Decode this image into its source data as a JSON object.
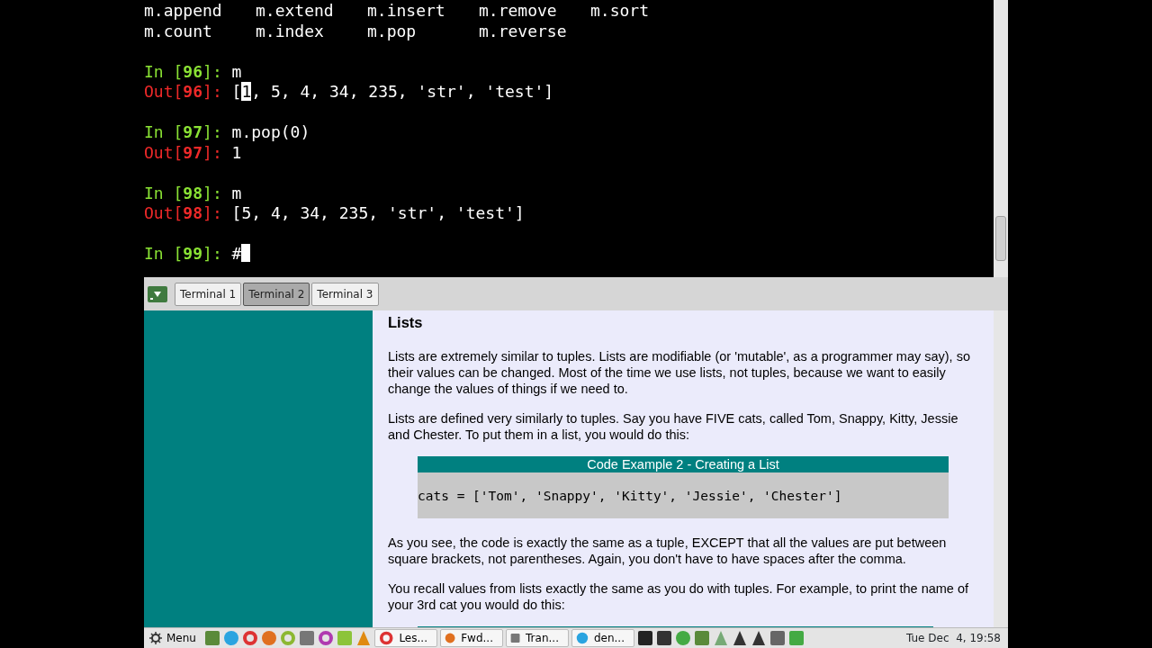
{
  "terminal": {
    "completions": [
      [
        "m.append",
        "m.extend",
        "m.insert",
        "m.remove",
        "m.sort"
      ],
      [
        "m.count",
        "m.index",
        "m.pop",
        "m.reverse"
      ]
    ],
    "entries": [
      {
        "kind": "blank"
      },
      {
        "kind": "in",
        "prompt": "In [**96**]:",
        "text": "m"
      },
      {
        "kind": "out",
        "prompt": "Out[**96**]:",
        "text": "[",
        "cursor_char": "1",
        "text_after": ", 5, 4, 34, 235, 'str', 'test']"
      },
      {
        "kind": "blank"
      },
      {
        "kind": "in",
        "prompt": "In [**97**]:",
        "text": "m.pop(0)"
      },
      {
        "kind": "out",
        "prompt": "Out[**97**]:",
        "text": "1"
      },
      {
        "kind": "blank"
      },
      {
        "kind": "in",
        "prompt": "In [**98**]:",
        "text": "m"
      },
      {
        "kind": "out",
        "prompt": "Out[**98**]:",
        "text": "[5, 4, 34, 235, 'str', 'test']"
      },
      {
        "kind": "blank"
      },
      {
        "kind": "in",
        "prompt": "In [**99**]:",
        "text": "#",
        "cursor": true
      }
    ]
  },
  "tabs": [
    {
      "label": "Terminal 1",
      "selected": false
    },
    {
      "label": "Terminal 2",
      "selected": true
    },
    {
      "label": "Terminal 3",
      "selected": false
    }
  ],
  "article": [
    {
      "kind": "heading",
      "text": "Lists"
    },
    {
      "kind": "paragraph",
      "text": "Lists are extremely similar to tuples. Lists are modifiable (or 'mutable', as a programmer may say), so their values can be changed. Most of the time we use lists, not tuples, because we want to easily change the values of things if we need to."
    },
    {
      "kind": "paragraph",
      "text": "Lists are defined very similarly to tuples. Say you have FIVE cats, called Tom, Snappy, Kitty, Jessie and Chester. To put them in a list, you would do this:"
    },
    {
      "kind": "code_example",
      "title": "Code Example 2 - Creating a List",
      "code": "cats = ['Tom', 'Snappy', 'Kitty', 'Jessie', 'Chester']"
    },
    {
      "kind": "paragraph",
      "text": "As you see, the code is exactly the same as a tuple, EXCEPT that all the values are put between square brackets, not parentheses. Again, you don't have to have spaces after the comma."
    },
    {
      "kind": "paragraph",
      "text": "You recall values from lists exactly the same as you do with tuples. For example, to print the name of your 3rd cat you would do this:"
    },
    {
      "kind": "cut_bar"
    }
  ],
  "taskbar": {
    "menu": "Menu",
    "windows": [
      {
        "label": "Les..."
      },
      {
        "label": "Fwd..."
      },
      {
        "label": "Tran..."
      },
      {
        "label": "den..."
      }
    ],
    "clock": "Tue Dec  4, 19:58"
  }
}
